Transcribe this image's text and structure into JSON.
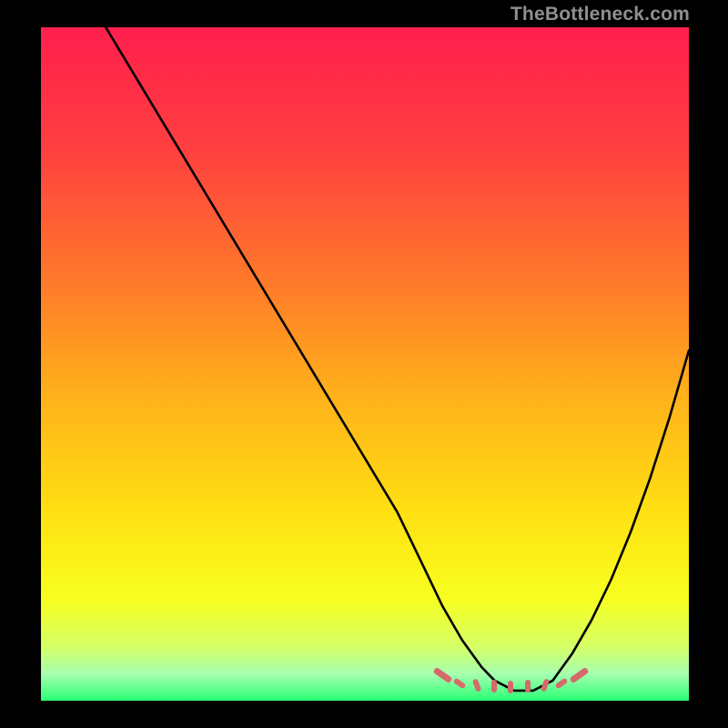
{
  "watermark": "TheBottleneck.com",
  "chart_data": {
    "type": "line",
    "title": "",
    "xlabel": "",
    "ylabel": "",
    "xlim": [
      0,
      100
    ],
    "ylim": [
      0,
      100
    ],
    "curve": {
      "x": [
        10,
        15,
        20,
        25,
        30,
        35,
        40,
        45,
        50,
        55,
        58,
        60,
        62,
        65,
        68,
        70,
        73,
        76,
        79,
        82,
        85,
        88,
        91,
        94,
        97,
        100
      ],
      "y": [
        100,
        92,
        84,
        76,
        68,
        60,
        52,
        44,
        36,
        28,
        22,
        18,
        14,
        9,
        5,
        3,
        1.5,
        1.5,
        3,
        7,
        12,
        18,
        25,
        33,
        42,
        52
      ]
    },
    "flat_zone": {
      "x_start": 62,
      "x_end": 83,
      "y": 2.5
    },
    "gradient_stops": [
      {
        "offset": 0,
        "color": "#ff1f4d"
      },
      {
        "offset": 18,
        "color": "#ff3f40"
      },
      {
        "offset": 38,
        "color": "#ff7a2a"
      },
      {
        "offset": 55,
        "color": "#ffb21a"
      },
      {
        "offset": 72,
        "color": "#ffe012"
      },
      {
        "offset": 85,
        "color": "#f7ff20"
      },
      {
        "offset": 92,
        "color": "#d4ff66"
      },
      {
        "offset": 96,
        "color": "#a6ffb0"
      },
      {
        "offset": 100,
        "color": "#2aff74"
      }
    ],
    "flat_dash_color": "#d46a6a"
  }
}
